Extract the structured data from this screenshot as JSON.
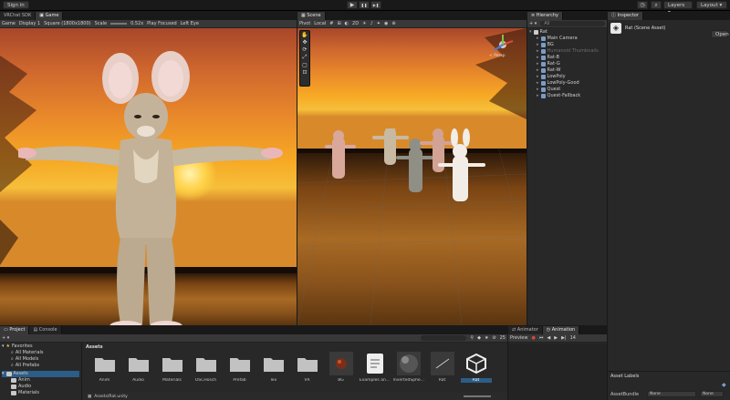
{
  "toolbar": {
    "sign_in": "Sign in",
    "play": "▶",
    "pause": "❚❚",
    "step": "▶❚",
    "layers": "Layers",
    "layout": "Layout"
  },
  "game": {
    "tabs": [
      "VRChat SDK",
      "Game"
    ],
    "display": "Game",
    "display_num": "Display 1",
    "aspect": "Square (1800x1800)",
    "scale_label": "Scale",
    "scale_value": "0.52x",
    "play_focused": "Play Focused",
    "eye": "Left Eye"
  },
  "scene": {
    "tab": "Scene",
    "pivot": "Pivot",
    "local": "Local",
    "persp": "< Persp"
  },
  "hierarchy": {
    "tab": "Hierarchy",
    "search_placeholder": "All",
    "items": [
      {
        "label": "Rat",
        "dim": false,
        "depth": 0
      },
      {
        "label": "Main Camera",
        "dim": false,
        "depth": 1
      },
      {
        "label": "BG",
        "dim": false,
        "depth": 1
      },
      {
        "label": "Humanoid Thumbnails",
        "dim": true,
        "depth": 1
      },
      {
        "label": "Rat-B",
        "dim": false,
        "depth": 1
      },
      {
        "label": "Rat-G",
        "dim": false,
        "depth": 1
      },
      {
        "label": "Rat-W",
        "dim": false,
        "depth": 1
      },
      {
        "label": "LowPoly",
        "dim": false,
        "depth": 1
      },
      {
        "label": "LowPoly-Good",
        "dim": false,
        "depth": 1
      },
      {
        "label": "Quest",
        "dim": false,
        "depth": 1
      },
      {
        "label": "Quest-Fallback",
        "dim": false,
        "depth": 1
      }
    ]
  },
  "inspector": {
    "tab": "Inspector",
    "title": "Rat (Scene Asset)",
    "open": "Open",
    "asset_labels": "Asset Labels",
    "asset_bundle": "AssetBundle",
    "bundle_none_1": "None",
    "bundle_none_2": "None"
  },
  "project": {
    "tabs": [
      "Project",
      "Console"
    ],
    "favorites": "Favorites",
    "fav_items": [
      "All Materials",
      "All Models",
      "All Prefabs"
    ],
    "assets": "Assets",
    "asset_tree": [
      "Anim",
      "Audio",
      "Materials"
    ],
    "breadcrumb": "Assets",
    "path": "Assets/Rat.unity",
    "count": "25",
    "assets_grid": [
      "Anim",
      "Audio",
      "Materials",
      "OSCHosch",
      "Prefab",
      "Tex",
      "VR",
      "BG",
      "Examples an...",
      "InvertedSphe...",
      "Rat",
      "Rat"
    ]
  },
  "animator": {
    "tabs": [
      "Animator",
      "Animation"
    ],
    "preview": "Preview",
    "frame": "14"
  },
  "colors": {
    "accent_blue": "#3d6fb6",
    "selected": "#2c5d87"
  }
}
